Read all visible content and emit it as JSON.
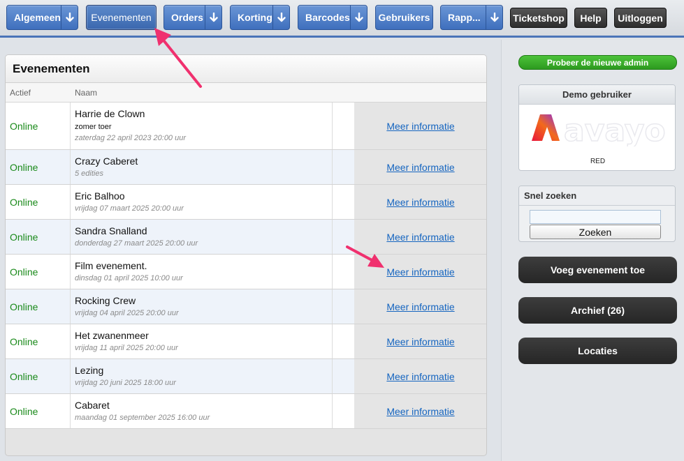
{
  "nav": {
    "items": [
      {
        "label": "Algemeen",
        "has_dropdown": true
      },
      {
        "label": "Evenementen",
        "has_dropdown": false,
        "active": true
      },
      {
        "label": "Orders",
        "has_dropdown": true
      },
      {
        "label": "Korting",
        "has_dropdown": true
      },
      {
        "label": "Barcodes",
        "has_dropdown": true
      },
      {
        "label": "Gebruikers",
        "has_dropdown": false
      },
      {
        "label": "Rapp...",
        "has_dropdown": true
      }
    ],
    "right": [
      {
        "label": "Ticketshop"
      },
      {
        "label": "Help"
      },
      {
        "label": "Uitloggen"
      }
    ],
    "dropdown_icon": "arrow-down-icon"
  },
  "events_panel": {
    "title": "Evenementen",
    "columns": {
      "status": "Actief",
      "name": "Naam"
    },
    "rows": [
      {
        "status": "Online",
        "title": "Harrie de Clown",
        "subtitle": "zomer toer",
        "meta": "zaterdag 22 april 2023 20:00 uur",
        "link": "Meer informatie"
      },
      {
        "status": "Online",
        "title": "Crazy Caberet",
        "meta": "5 edities",
        "link": "Meer informatie"
      },
      {
        "status": "Online",
        "title": "Eric Balhoo",
        "meta": "vrijdag 07 maart 2025 20:00 uur",
        "link": "Meer informatie"
      },
      {
        "status": "Online",
        "title": "Sandra Snalland",
        "meta": "donderdag 27 maart 2025 20:00 uur",
        "link": "Meer informatie"
      },
      {
        "status": "Online",
        "title": "Film evenement.",
        "meta": "dinsdag 01 april 2025 10:00 uur",
        "link": "Meer informatie"
      },
      {
        "status": "Online",
        "title": "Rocking Crew",
        "meta": "vrijdag 04 april 2025 20:00 uur",
        "link": "Meer informatie"
      },
      {
        "status": "Online",
        "title": "Het zwanenmeer",
        "meta": "vrijdag 11 april 2025 20:00 uur",
        "link": "Meer informatie"
      },
      {
        "status": "Online",
        "title": "Lezing",
        "meta": "vrijdag 20 juni 2025 18:00 uur",
        "link": "Meer informatie"
      },
      {
        "status": "Online",
        "title": "Cabaret",
        "meta": "maandag 01 september 2025 16:00 uur",
        "link": "Meer informatie"
      }
    ]
  },
  "sidebar": {
    "try_new_admin": "Probeer de nieuwe admin",
    "demo": {
      "title": "Demo gebruiker",
      "logo_text": "avayo",
      "logo_caption": "RED"
    },
    "quick_search": {
      "title": "Snel zoeken",
      "input_value": "",
      "button": "Zoeken"
    },
    "add_event": "Voeg evenement toe",
    "archive": "Archief (26)",
    "locations": "Locaties"
  },
  "colors": {
    "nav_blue": "#4a7cc7",
    "online_green": "#1a8a1a",
    "link_blue": "#1565c0",
    "annotation_arrow": "#f0306e",
    "try_button_green": "#3aad2a"
  }
}
